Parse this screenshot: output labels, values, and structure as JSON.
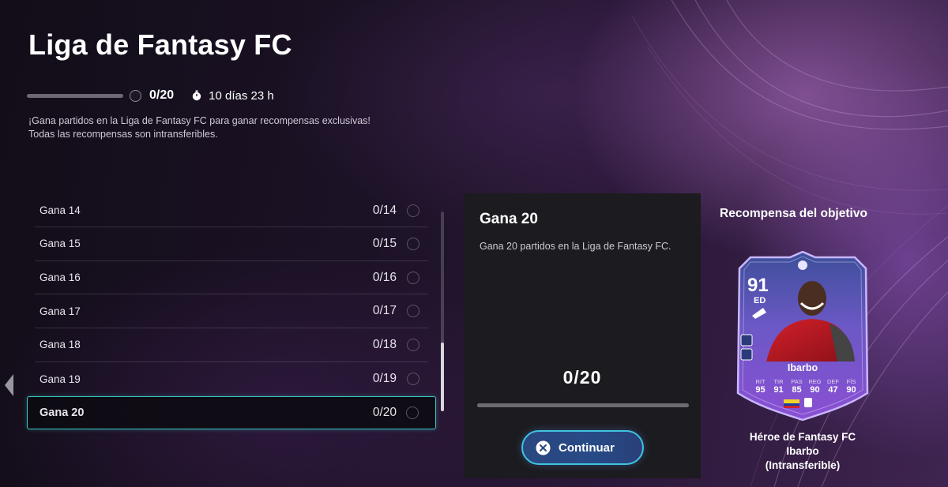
{
  "page": {
    "title": "Liga de Fantasy FC",
    "progress_value": "0/20",
    "progress_fraction": 0,
    "timer": "10 días 23 h",
    "description_line1": "¡Gana partidos en la Liga de Fantasy FC para ganar recompensas exclusivas!",
    "description_line2": "Todas las recompensas son intransferibles."
  },
  "objectives": [
    {
      "label": "Gana 14",
      "count": "0/14"
    },
    {
      "label": "Gana 15",
      "count": "0/15"
    },
    {
      "label": "Gana 16",
      "count": "0/16"
    },
    {
      "label": "Gana 17",
      "count": "0/17"
    },
    {
      "label": "Gana 18",
      "count": "0/18"
    },
    {
      "label": "Gana 19",
      "count": "0/19"
    },
    {
      "label": "Gana 20",
      "count": "0/20"
    }
  ],
  "detail": {
    "title": "Gana 20",
    "description": "Gana 20 partidos en la Liga de Fantasy FC.",
    "progress": "0/20",
    "progress_fraction": 0,
    "button_label": "Continuar"
  },
  "reward": {
    "heading": "Recompensa del objetivo",
    "card": {
      "rating": "91",
      "position": "ED",
      "name": "Ibarbo",
      "stats": [
        {
          "k": "RIT",
          "v": "95"
        },
        {
          "k": "TIR",
          "v": "91"
        },
        {
          "k": "PAS",
          "v": "85"
        },
        {
          "k": "REG",
          "v": "90"
        },
        {
          "k": "DEF",
          "v": "47"
        },
        {
          "k": "FÍS",
          "v": "90"
        }
      ]
    },
    "caption_line1": "Héroe de Fantasy FC",
    "caption_line2": "Ibarbo",
    "caption_line3": "(Intransferible)"
  },
  "colors": {
    "accent_cyan": "#3bc7c0",
    "button_blue": "#274a86",
    "panel_bg": "#1c1b1f",
    "card_purple": "#7b4fd0"
  },
  "icons": [
    "stopwatch-icon",
    "close-circle-icon",
    "chevron-left-icon",
    "boot-icon",
    "flag-icon",
    "league-badge-icon"
  ]
}
